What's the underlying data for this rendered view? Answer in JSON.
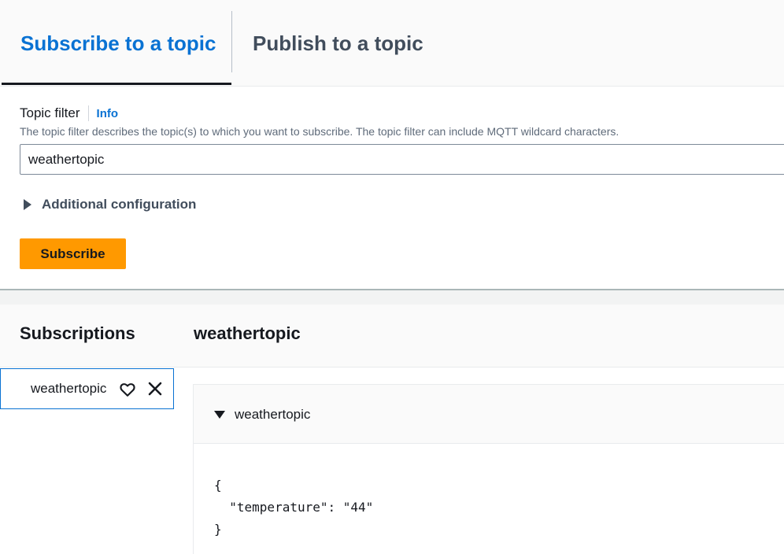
{
  "tabs": {
    "subscribe_label": "Subscribe to a topic",
    "publish_label": "Publish to a topic"
  },
  "form": {
    "topic_filter_label": "Topic filter",
    "info_link": "Info",
    "description": "The topic filter describes the topic(s) to which you want to subscribe. The topic filter can include MQTT wildcard characters.",
    "topic_filter_value": "weathertopic",
    "additional_config_label": "Additional configuration",
    "subscribe_button": "Subscribe"
  },
  "subscriptions": {
    "title": "Subscriptions",
    "selected_topic_title": "weathertopic",
    "items": [
      {
        "label": "weathertopic"
      }
    ]
  },
  "message": {
    "topic": "weathertopic",
    "payload": "{\n  \"temperature\": \"44\"\n}"
  },
  "colors": {
    "accent": "#0972d3",
    "primary_button": "#ff9900",
    "text": "#16191f"
  },
  "icons": [
    "caret-right-icon",
    "heart-icon",
    "close-icon",
    "caret-down-icon"
  ]
}
